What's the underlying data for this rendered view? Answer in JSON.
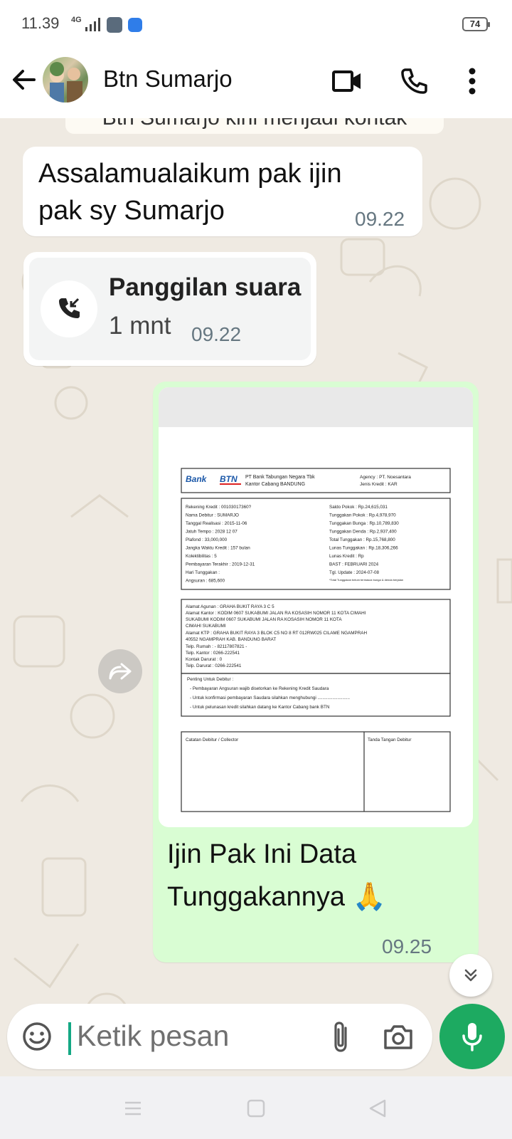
{
  "status_bar": {
    "time": "11.39",
    "network": "4G",
    "battery": "74"
  },
  "header": {
    "contact_name": "Btn Sumarjo"
  },
  "system_notice": "Btn Sumarjo kini menjadi kontak",
  "messages": [
    {
      "direction": "incoming",
      "text": "Assalamualaikum pak ijin pak sy Sumarjo",
      "time": "09.22"
    },
    {
      "direction": "incoming",
      "type": "voice-call",
      "title": "Panggilan suara",
      "duration": "1 mnt",
      "time": "09.22"
    },
    {
      "direction": "outgoing",
      "type": "image",
      "caption_line1": "Ijin Pak Ini Data",
      "caption_line2": "Tunggakannya 🙏",
      "time": "09.25"
    }
  ],
  "document": {
    "logo_bank": "Bank",
    "logo_btn": "BTN",
    "company": "PT Bank Tabungan Negara Tbk",
    "branch": "Kantor Cabang BANDUNG",
    "agency": "Agency      : PT. Noesantara",
    "credit_type": "Jenis Kredit : KAR",
    "left_fields": [
      "Rekening Kredit     : 00103017360?",
      "Nama Debitur          : SUMARJO",
      "Tanggal Realisasi   : 2015-11-06",
      "Jatuh Tempo           : 2028 12 07",
      "Plafond                   : 33,000,000",
      "Jangka Waktu Kredit : 157 bulan",
      "Kolektibilitas          : 5",
      "Pembayaran Terakhir : 2019-12-31",
      "Hari Tunggakan       :",
      "Angsuran                : 685,600"
    ],
    "right_fields": [
      "Saldo Pokok          : Rp.24,615,031",
      "Tunggakan Pokok   : Rp.4,978,970",
      "Tunggakan Bunga   : Rp.10,789,830",
      "Tunggakan Denda   : Rp.2,937,400",
      "Total Tunggakan     : Rp.15,768,800",
      "Lunas Tunggakan    : Rp.18,306,266",
      "Lunas Kredit           : Rp",
      "BAST                       : FEBRUARI 2024",
      "Tgl. Update             : 2024-07-08",
      "*Total Tunggakan belum termasuk bunga & denda berjalan"
    ],
    "address_lines": [
      "Alamat Agunan   :  GRAHA BUKIT RAYA 3 C 5",
      "Alamat Kantor    :  KODIM 0607 SUKABUMI JALAN RA KOSASIH NOMOR 11 KOTA CIMAHI",
      "                              SUKABUMI KODIM 0607 SUKABUMI JALAN RA KOSASIH NOMOR 11 KOTA",
      "                              CIMAHI SUKABUMI",
      "Alamat KTP        :  GRAHA BUKIT RAYA 3 BLOK C5 NO 8 RT 012RW025 CILAME NGAMPRAH",
      "                              40552 NGAMPRAH KAB. BANDUNG BARAT",
      "Telp. Rumah       :  - 82117807821 -",
      "Telp. Kantor        :  0266-222541",
      "Kontak Darurat    :  0",
      "Telp. Darurat      :  0266-222541"
    ],
    "notes_title": "Penting Untuk Debitur :",
    "notes": [
      "- Pembayaran Angsuran wajib disetorkan ke Rekening Kredit Saudara",
      "- Untuk konfirmasi pembayaran Saudara silahkan menghubungi ..........................",
      "- Untuk pelunasan kredit silahkan datang ke Kantor Cabang bank BTN"
    ],
    "footer_left": "Catatan Debitur / Collector",
    "footer_right": "Tanda Tangan Debitur"
  },
  "composer": {
    "placeholder": "Ketik pesan"
  },
  "icons": [
    "back-arrow-icon",
    "video-call-icon",
    "voice-call-icon",
    "more-menu-icon",
    "missed-call-icon",
    "forward-icon",
    "scroll-down-icon",
    "emoji-icon",
    "attach-icon",
    "camera-icon",
    "mic-icon"
  ],
  "colors": {
    "outgoing_bubble": "#d9fdd3",
    "incoming_bubble": "#ffffff",
    "chat_background": "#efeae2",
    "accent_green": "#1daa61",
    "timestamp": "#667781"
  }
}
